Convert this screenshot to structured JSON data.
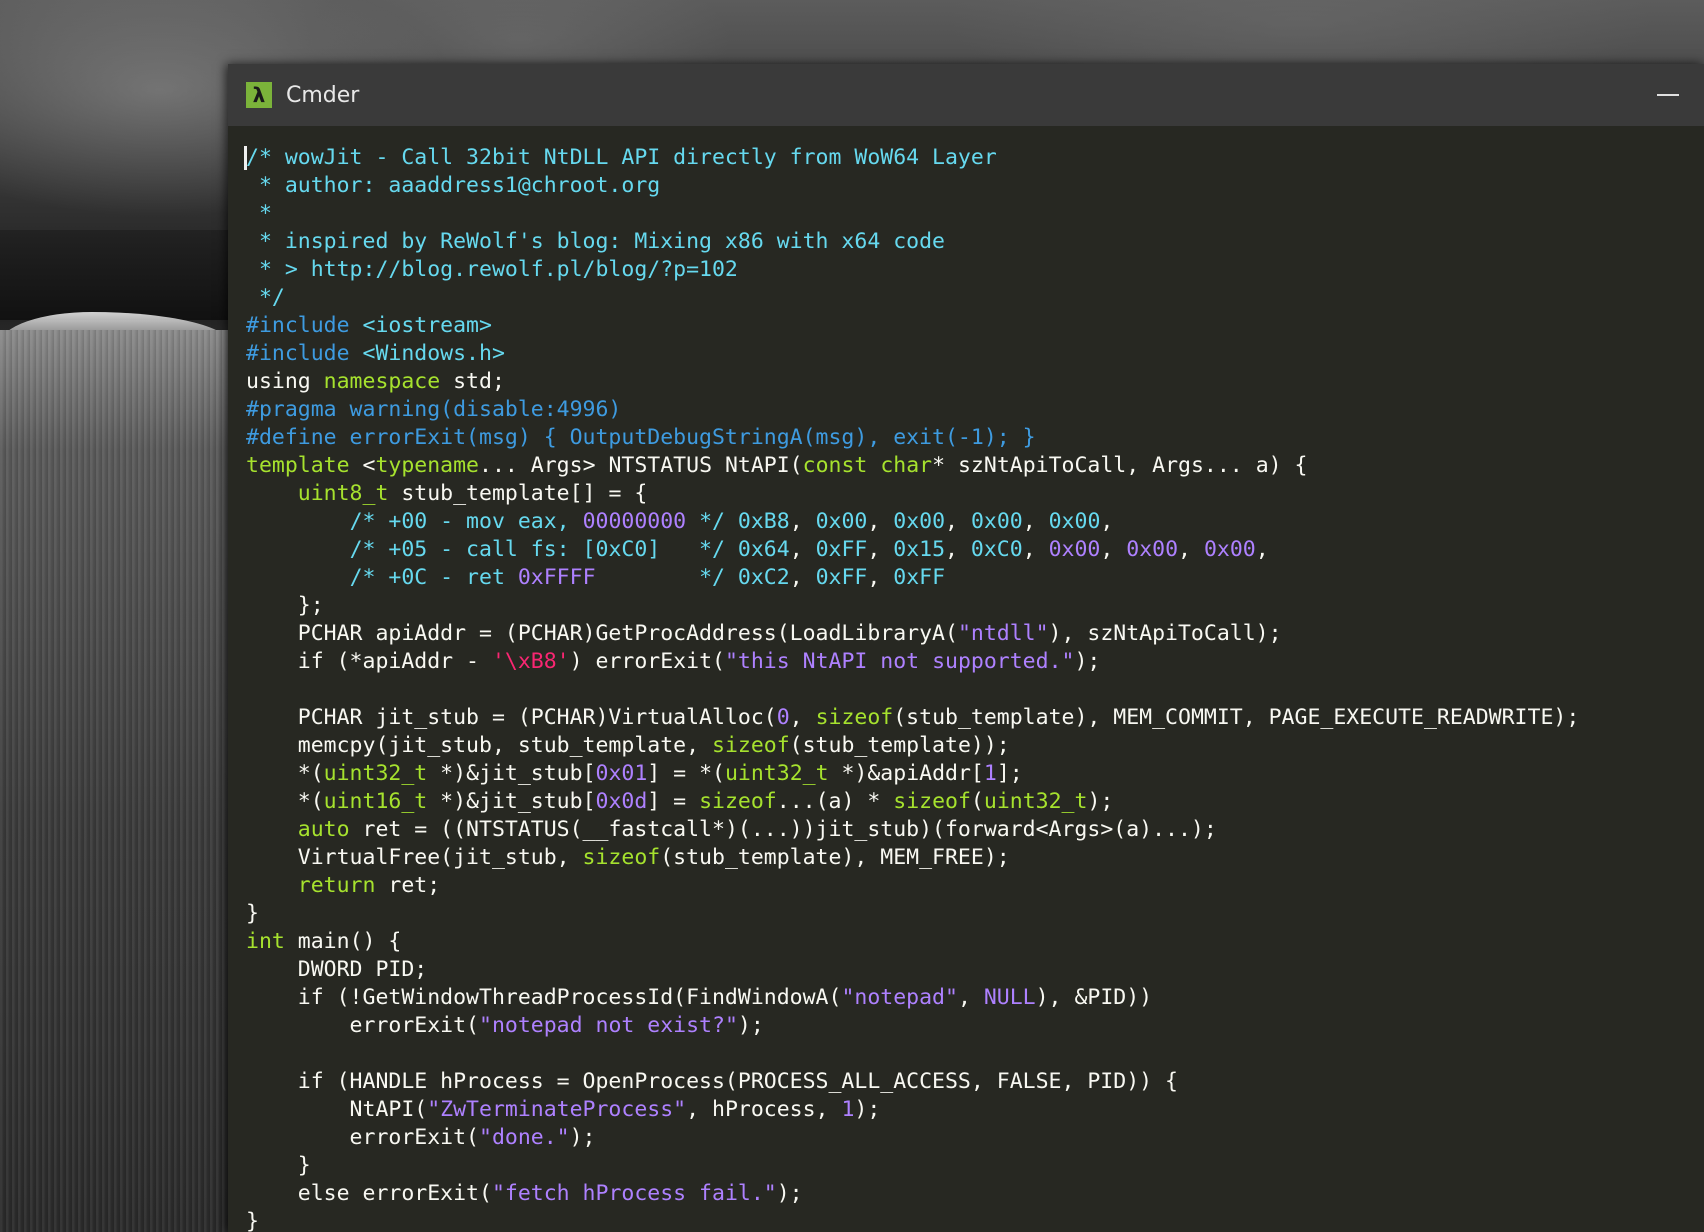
{
  "window": {
    "title": "Cmder",
    "icon": "lambda-icon",
    "icon_glyph": "λ"
  },
  "colors": {
    "background": "#272822",
    "titlebar": "#3a3a3a",
    "icon_bg": "#7bb33a",
    "comment": "#66d9ef",
    "preprocessor": "#3e9be0",
    "keyword": "#a6e22e",
    "string": "#ae81ff",
    "escape": "#f92672",
    "text": "#f8f8f2"
  },
  "code_lines": [
    [
      [
        "c",
        "/* wowJit - Call 32bit NtDLL API directly from WoW64 Layer"
      ]
    ],
    [
      [
        "c",
        " * author: aaaddress1@chroot.org"
      ]
    ],
    [
      [
        "c",
        " *"
      ]
    ],
    [
      [
        "c",
        " * inspired by ReWolf's blog: Mixing x86 with x64 code"
      ]
    ],
    [
      [
        "c",
        " * > http://blog.rewolf.pl/blog/?p=102"
      ]
    ],
    [
      [
        "c",
        " */"
      ]
    ],
    [
      [
        "p",
        "#include "
      ],
      [
        "c",
        "<iostream>"
      ]
    ],
    [
      [
        "p",
        "#include "
      ],
      [
        "c",
        "<Windows.h>"
      ]
    ],
    [
      [
        "t",
        "using "
      ],
      [
        "k",
        "namespace"
      ],
      [
        "t",
        " std;"
      ]
    ],
    [
      [
        "p",
        "#pragma warning(disable:4996)"
      ]
    ],
    [
      [
        "p",
        "#define errorExit(msg) { OutputDebugStringA(msg), exit(-1); }"
      ]
    ],
    [
      [
        "k",
        "template"
      ],
      [
        "t",
        " <"
      ],
      [
        "k",
        "typename"
      ],
      [
        "t",
        "... Args> NTSTATUS NtAPI("
      ],
      [
        "k",
        "const"
      ],
      [
        "t",
        " "
      ],
      [
        "k",
        "char"
      ],
      [
        "t",
        "* szNtApiToCall, Args... a) {"
      ]
    ],
    [
      [
        "t",
        "    "
      ],
      [
        "k",
        "uint8_t"
      ],
      [
        "t",
        " stub_template[] = {"
      ]
    ],
    [
      [
        "t",
        "        "
      ],
      [
        "c",
        "/* +00 - mov eax, "
      ],
      [
        "s",
        "00000000"
      ],
      [
        "c",
        " */"
      ],
      [
        "t",
        " "
      ],
      [
        "c",
        "0xB8"
      ],
      [
        "t",
        ", "
      ],
      [
        "c",
        "0x00"
      ],
      [
        "t",
        ", "
      ],
      [
        "c",
        "0x00"
      ],
      [
        "t",
        ", "
      ],
      [
        "c",
        "0x00"
      ],
      [
        "t",
        ", "
      ],
      [
        "c",
        "0x00"
      ],
      [
        "t",
        ","
      ]
    ],
    [
      [
        "t",
        "        "
      ],
      [
        "c",
        "/* +05 - call fs: [0xC0]   */"
      ],
      [
        "t",
        " "
      ],
      [
        "c",
        "0x64"
      ],
      [
        "t",
        ", "
      ],
      [
        "c",
        "0xFF"
      ],
      [
        "t",
        ", "
      ],
      [
        "c",
        "0x15"
      ],
      [
        "t",
        ", "
      ],
      [
        "c",
        "0xC0"
      ],
      [
        "t",
        ", "
      ],
      [
        "s",
        "0x00"
      ],
      [
        "t",
        ", "
      ],
      [
        "s",
        "0x00"
      ],
      [
        "t",
        ", "
      ],
      [
        "s",
        "0x00"
      ],
      [
        "t",
        ","
      ]
    ],
    [
      [
        "t",
        "        "
      ],
      [
        "c",
        "/* +0C - ret "
      ],
      [
        "s",
        "0xFFFF"
      ],
      [
        "c",
        "        */"
      ],
      [
        "t",
        " "
      ],
      [
        "c",
        "0xC2"
      ],
      [
        "t",
        ", "
      ],
      [
        "c",
        "0xFF"
      ],
      [
        "t",
        ", "
      ],
      [
        "c",
        "0xFF"
      ]
    ],
    [
      [
        "t",
        "    };"
      ]
    ],
    [
      [
        "t",
        "    PCHAR apiAddr = (PCHAR)GetProcAddress(LoadLibraryA("
      ],
      [
        "s",
        "\"ntdll\""
      ],
      [
        "t",
        "), szNtApiToCall);"
      ]
    ],
    [
      [
        "t",
        "    if (*apiAddr - "
      ],
      [
        "r",
        "'\\xB8'"
      ],
      [
        "t",
        ") errorExit("
      ],
      [
        "s",
        "\"this NtAPI not supported.\""
      ],
      [
        "t",
        ");"
      ]
    ],
    [
      [
        "t",
        ""
      ]
    ],
    [
      [
        "t",
        "    PCHAR jit_stub = (PCHAR)VirtualAlloc("
      ],
      [
        "s",
        "0"
      ],
      [
        "t",
        ", "
      ],
      [
        "k",
        "sizeof"
      ],
      [
        "t",
        "(stub_template), MEM_COMMIT, PAGE_EXECUTE_READWRITE);"
      ]
    ],
    [
      [
        "t",
        "    memcpy(jit_stub, stub_template, "
      ],
      [
        "k",
        "sizeof"
      ],
      [
        "t",
        "(stub_template));"
      ]
    ],
    [
      [
        "t",
        "    *("
      ],
      [
        "k",
        "uint32_t"
      ],
      [
        "t",
        " *)&jit_stub["
      ],
      [
        "s",
        "0x01"
      ],
      [
        "t",
        "] = *("
      ],
      [
        "k",
        "uint32_t"
      ],
      [
        "t",
        " *)&apiAddr["
      ],
      [
        "s",
        "1"
      ],
      [
        "t",
        "];"
      ]
    ],
    [
      [
        "t",
        "    *("
      ],
      [
        "k",
        "uint16_t"
      ],
      [
        "t",
        " *)&jit_stub["
      ],
      [
        "s",
        "0x0d"
      ],
      [
        "t",
        "] = "
      ],
      [
        "k",
        "sizeof"
      ],
      [
        "t",
        "...(a) * "
      ],
      [
        "k",
        "sizeof"
      ],
      [
        "t",
        "("
      ],
      [
        "k",
        "uint32_t"
      ],
      [
        "t",
        ");"
      ]
    ],
    [
      [
        "t",
        "    "
      ],
      [
        "k",
        "auto"
      ],
      [
        "t",
        " ret = ((NTSTATUS(__fastcall*)(...))jit_stub)(forward<Args>(a)...);"
      ]
    ],
    [
      [
        "t",
        "    VirtualFree(jit_stub, "
      ],
      [
        "k",
        "sizeof"
      ],
      [
        "t",
        "(stub_template), MEM_FREE);"
      ]
    ],
    [
      [
        "t",
        "    "
      ],
      [
        "k",
        "return"
      ],
      [
        "t",
        " ret;"
      ]
    ],
    [
      [
        "t",
        "}"
      ]
    ],
    [
      [
        "k",
        "int"
      ],
      [
        "t",
        " main() {"
      ]
    ],
    [
      [
        "t",
        "    DWORD PID;"
      ]
    ],
    [
      [
        "t",
        "    if (!GetWindowThreadProcessId(FindWindowA("
      ],
      [
        "s",
        "\"notepad\""
      ],
      [
        "t",
        ", "
      ],
      [
        "s",
        "NULL"
      ],
      [
        "t",
        "), &PID))"
      ]
    ],
    [
      [
        "t",
        "        errorExit("
      ],
      [
        "s",
        "\"notepad not exist?\""
      ],
      [
        "t",
        ");"
      ]
    ],
    [
      [
        "t",
        ""
      ]
    ],
    [
      [
        "t",
        "    if (HANDLE hProcess = OpenProcess(PROCESS_ALL_ACCESS, FALSE, PID)) {"
      ]
    ],
    [
      [
        "t",
        "        NtAPI("
      ],
      [
        "s",
        "\"ZwTerminateProcess\""
      ],
      [
        "t",
        ", hProcess, "
      ],
      [
        "s",
        "1"
      ],
      [
        "t",
        ");"
      ]
    ],
    [
      [
        "t",
        "        errorExit("
      ],
      [
        "s",
        "\"done.\""
      ],
      [
        "t",
        ");"
      ]
    ],
    [
      [
        "t",
        "    }"
      ]
    ],
    [
      [
        "t",
        "    else errorExit("
      ],
      [
        "s",
        "\"fetch hProcess fail.\""
      ],
      [
        "t",
        ");"
      ]
    ],
    [
      [
        "t",
        "}"
      ]
    ]
  ]
}
